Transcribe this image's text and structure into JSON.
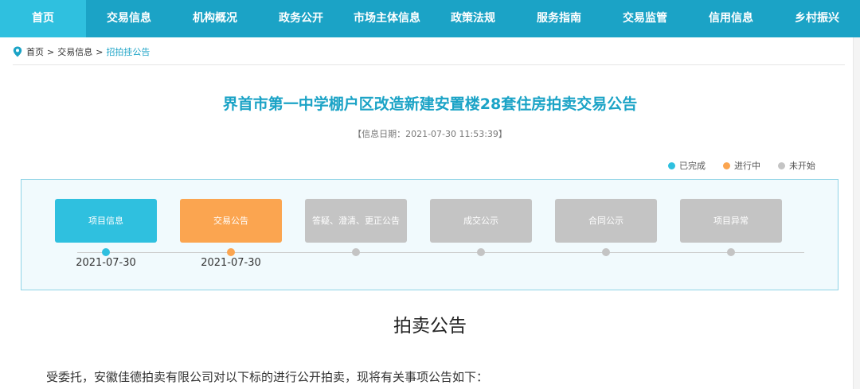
{
  "nav": {
    "items": [
      {
        "label": "首页",
        "active": true
      },
      {
        "label": "交易信息",
        "active": false
      },
      {
        "label": "机构概况",
        "active": false
      },
      {
        "label": "政务公开",
        "active": false
      },
      {
        "label": "市场主体信息",
        "active": false
      },
      {
        "label": "政策法规",
        "active": false
      },
      {
        "label": "服务指南",
        "active": false
      },
      {
        "label": "交易监管",
        "active": false
      },
      {
        "label": "信用信息",
        "active": false
      },
      {
        "label": "乡村振兴",
        "active": false
      }
    ]
  },
  "breadcrumb": {
    "icon": "location-pin-icon",
    "home": "首页",
    "sep": ">",
    "level1": "交易信息",
    "current": "招拍挂公告"
  },
  "page": {
    "title": "界首市第一中学棚户区改造新建安置楼28套住房拍卖交易公告",
    "date_text": "【信息日期：2021-07-30 11:53:39】"
  },
  "legend": [
    {
      "label": "已完成",
      "color": "#2fc0df"
    },
    {
      "label": "进行中",
      "color": "#fba550"
    },
    {
      "label": "未开始",
      "color": "#c4c4c4"
    }
  ],
  "steps": [
    {
      "label": "项目信息",
      "status": "done",
      "date": "2021-07-30"
    },
    {
      "label": "交易公告",
      "status": "active",
      "date": "2021-07-30"
    },
    {
      "label": "答疑、澄清、更正公告",
      "status": "pending",
      "date": ""
    },
    {
      "label": "成交公示",
      "status": "pending",
      "date": ""
    },
    {
      "label": "合同公示",
      "status": "pending",
      "date": ""
    },
    {
      "label": "项目异常",
      "status": "pending",
      "date": ""
    }
  ],
  "colors": {
    "nav_bg": "#1ba3c6",
    "nav_active": "#2fc0df",
    "done": "#2fc0df",
    "active": "#fba550",
    "pending": "#c4c4c4"
  },
  "announcement": {
    "heading": "拍卖公告",
    "intro": "受委托，安徽佳德拍卖有限公司对以下标的进行公开拍卖，现将有关事项公告如下："
  }
}
